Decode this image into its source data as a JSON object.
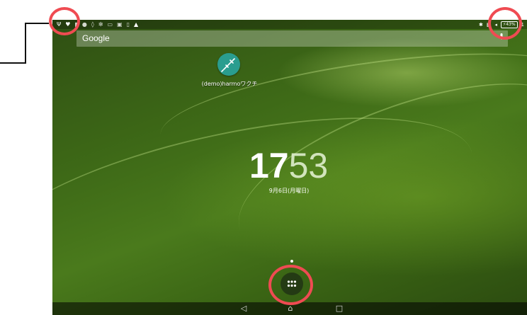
{
  "status_bar": {
    "left_icons": [
      "usb-icon",
      "heart-icon",
      "signal-icon",
      "mail-icon",
      "location-icon",
      "fan-icon",
      "image-icon",
      "gallery-icon",
      "sim-icon",
      "warning-icon"
    ],
    "battery": "43%",
    "time_partial": "1"
  },
  "search": {
    "label": "Google"
  },
  "app": {
    "label": "(demo)harmoワクチ"
  },
  "clock": {
    "hour": "17",
    "minute": "53",
    "date": "9月6日(月曜日)"
  },
  "nav": {
    "back": "◁",
    "home": "⌂",
    "recents": "□"
  },
  "highlight_color": "#ef4b52"
}
